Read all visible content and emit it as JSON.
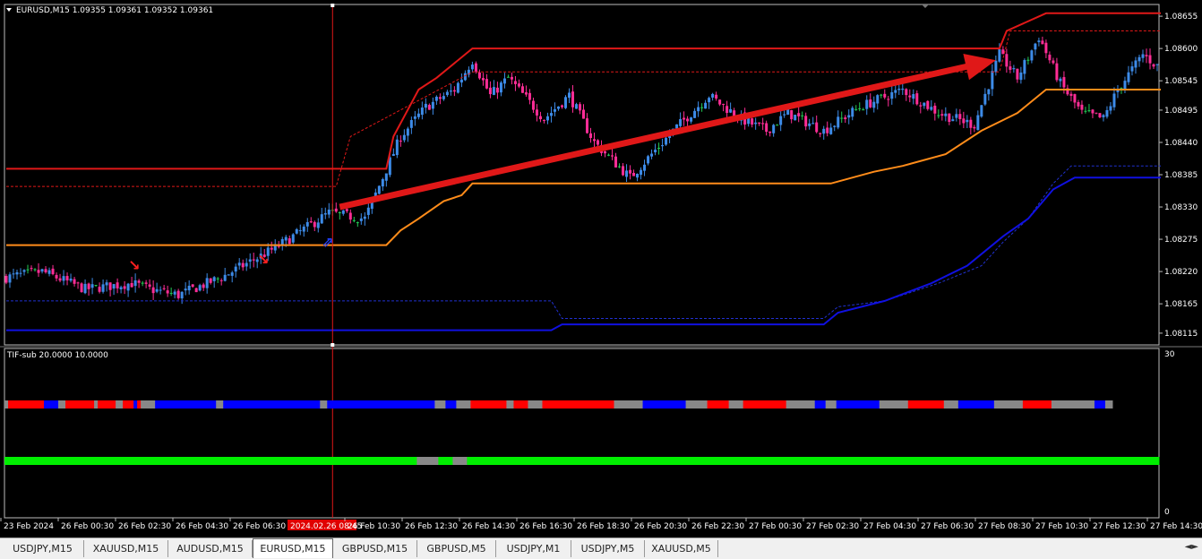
{
  "header": {
    "symbol_line": "EURUSD,M15  1.09355 1.09361 1.09352 1.09361"
  },
  "subwindow": {
    "label": "TIF-sub 20.0000 10.0000",
    "scale_max": "30",
    "scale_min": "0"
  },
  "chart_data": {
    "type": "candlestick",
    "title": "EURUSD,M15",
    "ohlc_last": {
      "open": "1.09355",
      "high": "1.09361",
      "low": "1.09352",
      "close": "1.09361"
    },
    "ylim": [
      1.08095,
      1.08675
    ],
    "y_ticks": [
      "1.08655",
      "1.08600",
      "1.08545",
      "1.08495",
      "1.08440",
      "1.08385",
      "1.08330",
      "1.08275",
      "1.08220",
      "1.08165",
      "1.08115"
    ],
    "x_ticks": [
      "23 Feb 2024",
      "26 Feb 00:30",
      "26 Feb 02:30",
      "26 Feb 04:30",
      "26 Feb 06:30",
      "2024.02.26 08:45",
      "26 Feb 10:30",
      "26 Feb 12:30",
      "26 Feb 14:30",
      "26 Feb 16:30",
      "26 Feb 18:30",
      "26 Feb 20:30",
      "26 Feb 22:30",
      "27 Feb 00:30",
      "27 Feb 02:30",
      "27 Feb 04:30",
      "27 Feb 06:30",
      "27 Feb 08:30",
      "27 Feb 10:30",
      "27 Feb 12:30",
      "27 Feb 14:30"
    ],
    "highlighted_time": "2024.02.26 08:45",
    "close_anchors": [
      [
        0,
        1.0821
      ],
      [
        10,
        1.0822
      ],
      [
        22,
        1.0819
      ],
      [
        35,
        1.082
      ],
      [
        40,
        1.0819
      ],
      [
        48,
        1.0818
      ],
      [
        60,
        1.0821
      ],
      [
        75,
        1.0826
      ],
      [
        90,
        1.0832
      ],
      [
        100,
        1.0831
      ],
      [
        105,
        1.0838
      ],
      [
        110,
        1.0845
      ],
      [
        117,
        1.085
      ],
      [
        125,
        1.0853
      ],
      [
        130,
        1.0858
      ],
      [
        135,
        1.0852
      ],
      [
        140,
        1.0855
      ],
      [
        150,
        1.0848
      ],
      [
        157,
        1.0852
      ],
      [
        164,
        1.0844
      ],
      [
        174,
        1.0838
      ],
      [
        186,
        1.0846
      ],
      [
        196,
        1.0852
      ],
      [
        205,
        1.0848
      ],
      [
        212,
        1.0846
      ],
      [
        218,
        1.0849
      ],
      [
        228,
        1.0846
      ],
      [
        238,
        1.085
      ],
      [
        250,
        1.0853
      ],
      [
        260,
        1.0849
      ],
      [
        270,
        1.0847
      ],
      [
        277,
        1.0859
      ],
      [
        282,
        1.0855
      ],
      [
        288,
        1.0862
      ],
      [
        294,
        1.0854
      ],
      [
        300,
        1.0849
      ],
      [
        306,
        1.0848
      ],
      [
        310,
        1.0853
      ],
      [
        317,
        1.0859
      ],
      [
        321,
        1.0857
      ]
    ],
    "series": [
      {
        "name": "upper_band",
        "color": "#e01818",
        "points": [
          [
            0,
            1.08395
          ],
          [
            106,
            1.08395
          ],
          [
            108,
            1.0845
          ],
          [
            115,
            1.0853
          ],
          [
            120,
            1.0855
          ],
          [
            130,
            1.086
          ],
          [
            277,
            1.086
          ],
          [
            279,
            1.0863
          ],
          [
            290,
            1.0866
          ],
          [
            322,
            1.0866
          ]
        ]
      },
      {
        "name": "upper_dashed",
        "color": "#e01818",
        "points": [
          [
            0,
            1.08365
          ],
          [
            92,
            1.08365
          ],
          [
            96,
            1.0845
          ],
          [
            130,
            1.0856
          ],
          [
            277,
            1.0856
          ],
          [
            280,
            1.0863
          ],
          [
            322,
            1.0863
          ]
        ]
      },
      {
        "name": "middle_line",
        "color": "#ff8c1a",
        "points": [
          [
            0,
            1.08265
          ],
          [
            106,
            1.08265
          ],
          [
            110,
            1.0829
          ],
          [
            115,
            1.0831
          ],
          [
            122,
            1.0834
          ],
          [
            127,
            1.0835
          ],
          [
            130,
            1.0837
          ],
          [
            230,
            1.0837
          ],
          [
            242,
            1.0839
          ],
          [
            250,
            1.084
          ],
          [
            262,
            1.0842
          ],
          [
            272,
            1.0846
          ],
          [
            282,
            1.0849
          ],
          [
            290,
            1.0853
          ],
          [
            295,
            1.0853
          ],
          [
            322,
            1.0853
          ]
        ]
      },
      {
        "name": "lower_dashed",
        "color": "#2030d0",
        "points": [
          [
            0,
            1.0817
          ],
          [
            152,
            1.0817
          ],
          [
            155,
            1.0814
          ],
          [
            228,
            1.0814
          ],
          [
            232,
            1.0816
          ],
          [
            245,
            1.0817
          ],
          [
            260,
            1.082
          ],
          [
            272,
            1.0823
          ],
          [
            278,
            1.0827
          ],
          [
            285,
            1.0831
          ],
          [
            292,
            1.0837
          ],
          [
            297,
            1.084
          ],
          [
            322,
            1.084
          ]
        ]
      },
      {
        "name": "lower_band",
        "color": "#1010e0",
        "points": [
          [
            0,
            1.0812
          ],
          [
            152,
            1.0812
          ],
          [
            155,
            1.0813
          ],
          [
            228,
            1.0813
          ],
          [
            232,
            1.0815
          ],
          [
            245,
            1.0817
          ],
          [
            258,
            1.082
          ],
          [
            268,
            1.0823
          ],
          [
            278,
            1.0828
          ],
          [
            285,
            1.0831
          ],
          [
            292,
            1.0836
          ],
          [
            298,
            1.0838
          ],
          [
            322,
            1.0838
          ]
        ]
      }
    ],
    "arrow": {
      "color": "#e01818",
      "from": [
        93,
        1.0833
      ],
      "to": [
        276,
        1.0858
      ]
    },
    "signals": [
      {
        "type": "down-arrow",
        "x": 34,
        "y": 1.0823,
        "color": "#ff2020"
      },
      {
        "type": "down-arrow",
        "x": 70,
        "y": 1.0824,
        "color": "#ff2020"
      },
      {
        "type": "up-arrow",
        "x": 88,
        "y": 1.0827,
        "color": "#2040ff"
      }
    ],
    "vertical_marker_index": 91,
    "sub_bar1_segments": [
      [
        "#888888",
        1
      ],
      [
        "#ff0000",
        10
      ],
      [
        "#0000ff",
        4
      ],
      [
        "#888888",
        2
      ],
      [
        "#ff0000",
        8
      ],
      [
        "#888888",
        1
      ],
      [
        "#ff0000",
        5
      ],
      [
        "#888888",
        2
      ],
      [
        "#ff0000",
        3
      ],
      [
        "#0000ff",
        1
      ],
      [
        "#ff0000",
        1
      ],
      [
        "#888888",
        4
      ],
      [
        "#0000ff",
        17
      ],
      [
        "#888888",
        2
      ],
      [
        "#0000ff",
        27
      ],
      [
        "#888888",
        2
      ],
      [
        "#0000ff",
        30
      ],
      [
        "#888888",
        3
      ],
      [
        "#0000ff",
        3
      ],
      [
        "#888888",
        4
      ],
      [
        "#ff0000",
        10
      ],
      [
        "#888888",
        2
      ],
      [
        "#ff0000",
        4
      ],
      [
        "#888888",
        4
      ],
      [
        "#ff0000",
        20
      ],
      [
        "#888888",
        8
      ],
      [
        "#0000ff",
        12
      ],
      [
        "#888888",
        6
      ],
      [
        "#ff0000",
        6
      ],
      [
        "#888888",
        4
      ],
      [
        "#ff0000",
        12
      ],
      [
        "#888888",
        8
      ],
      [
        "#0000ff",
        3
      ],
      [
        "#888888",
        3
      ],
      [
        "#0000ff",
        12
      ],
      [
        "#888888",
        8
      ],
      [
        "#ff0000",
        10
      ],
      [
        "#888888",
        4
      ],
      [
        "#0000ff",
        10
      ],
      [
        "#888888",
        8
      ],
      [
        "#ff0000",
        8
      ],
      [
        "#888888",
        12
      ],
      [
        "#0000ff",
        3
      ],
      [
        "#888888",
        2
      ]
    ],
    "sub_bar2_segments": [
      [
        "#00ee00",
        115
      ],
      [
        "#888888",
        6
      ],
      [
        "#00ee00",
        4
      ],
      [
        "#888888",
        4
      ],
      [
        "#00ee00",
        193
      ]
    ]
  },
  "tabs": [
    {
      "label": "USDJPY,M15"
    },
    {
      "label": "XAUUSD,M15"
    },
    {
      "label": "AUDUSD,M15"
    },
    {
      "label": "EURUSD,M15",
      "active": true
    },
    {
      "label": "GBPUSD,M15"
    },
    {
      "label": "GBPUSD,M5"
    },
    {
      "label": "USDJPY,M1"
    },
    {
      "label": "USDJPY,M5"
    },
    {
      "label": "XAUUSD,M5"
    }
  ],
  "scroll_glyph": "◄►",
  "colors": {
    "bull": "#3d8be8",
    "bear": "#ff2d96",
    "doji": "#22cc55",
    "axis_text": "#ffffff",
    "frame": "#bbbbbb"
  }
}
